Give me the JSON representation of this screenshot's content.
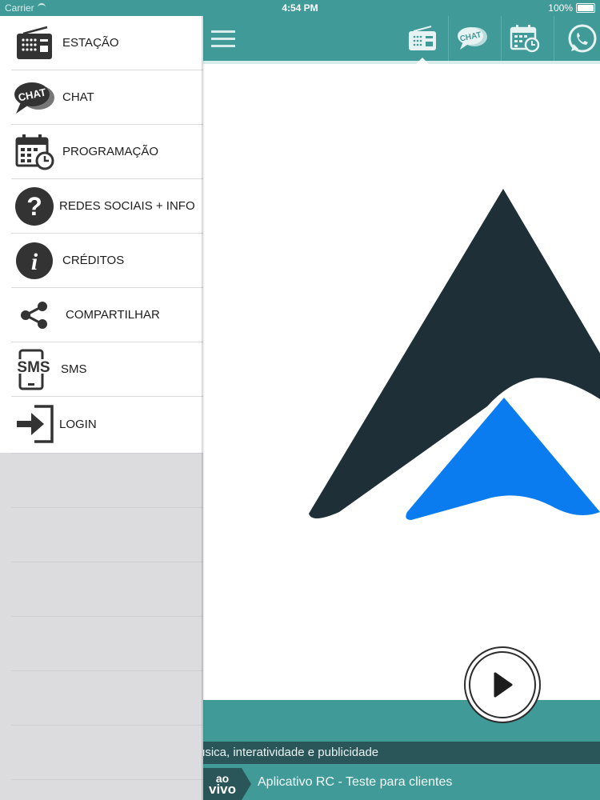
{
  "status_bar": {
    "carrier": "Carrier",
    "time": "4:54 PM",
    "battery": "100%"
  },
  "top_tabs": [
    {
      "icon": "radio-icon",
      "active": true
    },
    {
      "icon": "chat-icon",
      "active": false
    },
    {
      "icon": "calendar-clock-icon",
      "active": false
    },
    {
      "icon": "whatsapp-icon",
      "active": false
    }
  ],
  "menu": {
    "items": [
      {
        "label": "ESTAÇÃO",
        "icon": "radio-icon"
      },
      {
        "label": "CHAT",
        "icon": "chat-icon"
      },
      {
        "label": "PROGRAMAÇÃO",
        "icon": "calendar-clock-icon"
      },
      {
        "label": "REDES SOCIAIS + INFO",
        "icon": "question-icon"
      },
      {
        "label": "CRÉDITOS",
        "icon": "info-icon"
      },
      {
        "label": "COMPARTILHAR",
        "icon": "share-icon"
      },
      {
        "label": "SMS",
        "icon": "sms-phone-icon",
        "icon_text": "SMS"
      },
      {
        "label": "LOGIN",
        "icon": "login-icon"
      }
    ]
  },
  "chat_icon_text": "CHAT",
  "player": {
    "ticker": "úsica, interatividade e publicidade",
    "live_badge": {
      "line1": "ao",
      "line2": "vivo"
    },
    "now_playing": "Aplicativo RC - Teste para clientes"
  },
  "colors": {
    "teal": "#3f9a98",
    "dark_teal": "#2b5659",
    "logo_dark": "#1e2f37",
    "logo_blue": "#0a7cf0",
    "menu_icon": "#333333"
  }
}
